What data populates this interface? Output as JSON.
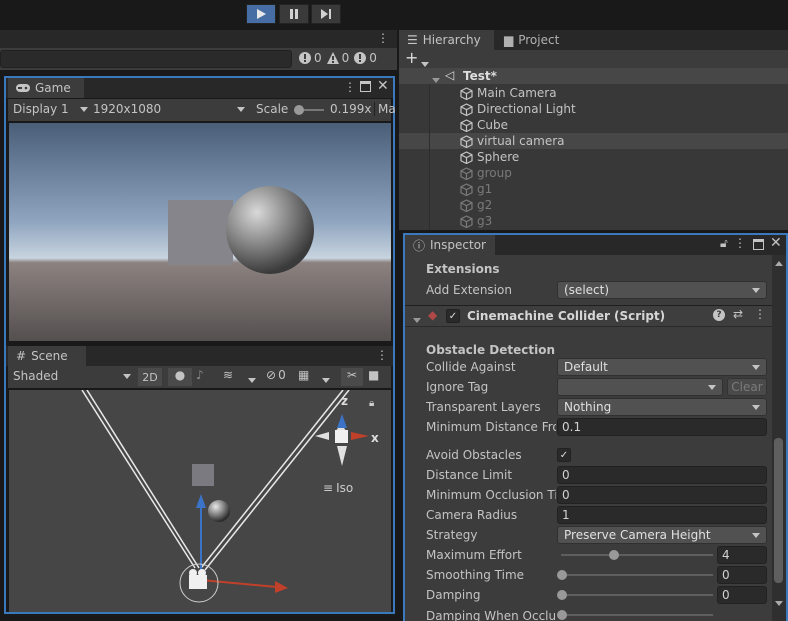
{
  "toolbar": {
    "play_icon": "play-icon",
    "pause_icon": "pause-icon",
    "step_icon": "step-icon"
  },
  "console": {
    "errors": "0",
    "warnings": "0",
    "messages": "0"
  },
  "game": {
    "tab": "Game",
    "display": "Display 1",
    "resolution": "1920x1080",
    "scale_label": "Scale",
    "scale_value": "0.199x",
    "maximize_label": "Ma"
  },
  "scene": {
    "tab": "Scene",
    "shading": "Shaded",
    "mode_2d": "2D",
    "hidden_count": "0",
    "iso_label": "Iso",
    "axis_x": "x",
    "axis_z": "z"
  },
  "hierarchy": {
    "tab": "Hierarchy",
    "project_tab": "Project",
    "scene_name": "Test*",
    "items": [
      {
        "label": "Main Camera",
        "dim": false
      },
      {
        "label": "Directional Light",
        "dim": false
      },
      {
        "label": "Cube",
        "dim": false
      },
      {
        "label": "virtual camera",
        "dim": false,
        "selected": true
      },
      {
        "label": "Sphere",
        "dim": false
      },
      {
        "label": "group",
        "dim": true
      },
      {
        "label": "g1",
        "dim": true
      },
      {
        "label": "g2",
        "dim": true
      },
      {
        "label": "g3",
        "dim": true
      }
    ]
  },
  "inspector": {
    "tab": "Inspector",
    "extensions_header": "Extensions",
    "add_extension_label": "Add Extension",
    "add_extension_value": "(select)",
    "component_title": "Cinemachine Collider (Script)",
    "section": "Obstacle Detection",
    "collide_against_label": "Collide Against",
    "collide_against_value": "Default",
    "ignore_tag_label": "Ignore Tag",
    "ignore_tag_value": "",
    "clear_label": "Clear",
    "transparent_layers_label": "Transparent Layers",
    "transparent_layers_value": "Nothing",
    "min_distance_label": "Minimum Distance From",
    "min_distance_value": "0.1",
    "avoid_obstacles_label": "Avoid Obstacles",
    "avoid_obstacles_checked": true,
    "distance_limit_label": "Distance Limit",
    "distance_limit_value": "0",
    "min_occlusion_label": "Minimum Occlusion Time",
    "min_occlusion_value": "0",
    "camera_radius_label": "Camera Radius",
    "camera_radius_value": "1",
    "strategy_label": "Strategy",
    "strategy_value": "Preserve Camera Height",
    "max_effort_label": "Maximum Effort",
    "max_effort_value": "4",
    "max_effort_fraction": 0.35,
    "smoothing_time_label": "Smoothing Time",
    "smoothing_time_value": "0",
    "damping_label": "Damping",
    "damping_value": "0",
    "damping_occluded_label": "Damping When Occluded"
  }
}
